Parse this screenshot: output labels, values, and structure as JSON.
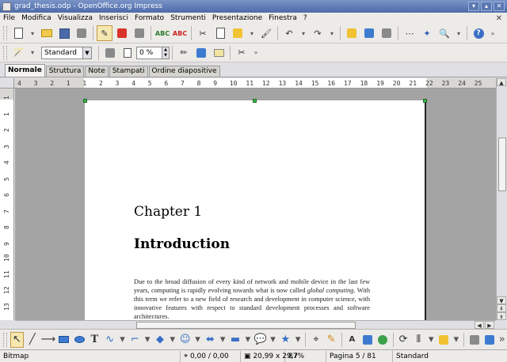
{
  "window": {
    "title": "grad_thesis.odp - OpenOffice.org Impress",
    "controls": [
      "▾",
      "▴",
      "✕"
    ]
  },
  "menu": [
    "File",
    "Modifica",
    "Visualizza",
    "Inserisci",
    "Formato",
    "Strumenti",
    "Presentazione",
    "Finestra",
    "?"
  ],
  "toolbar2": {
    "style_value": "Standard",
    "transparency_value": "0 %"
  },
  "tabs": [
    "Normale",
    "Struttura",
    "Note",
    "Stampati",
    "Ordine diapositive"
  ],
  "ruler": {
    "h_ticks": [
      "4",
      "3",
      "2",
      "1",
      "1",
      "2",
      "3",
      "4",
      "5",
      "6",
      "7",
      "8",
      "9",
      "10",
      "11",
      "12",
      "13",
      "14",
      "15",
      "16",
      "17",
      "18",
      "19",
      "20",
      "21",
      "22",
      "23",
      "24",
      "25"
    ],
    "v_ticks": [
      "1",
      "1",
      "2",
      "3",
      "4",
      "5",
      "6",
      "7",
      "8",
      "9",
      "10",
      "11",
      "12",
      "13"
    ]
  },
  "slide": {
    "chapter": "Chapter 1",
    "heading": "Introduction",
    "paragraph_start": "Due to the broad diffusion of every kind of network and mobile device in the last few years, computing is rapidly evolving towards what is now called ",
    "paragraph_em": "global computing.",
    "paragraph_end": " With this term we refer to a new field of research and development in computer science, with innovative features with respect to standard development processes and software architectures."
  },
  "status": {
    "object": "Bitmap",
    "position": "0,00 / 0,00",
    "size": "20,99 x 29,7",
    "zoom": "87%",
    "page": "Pagina 5 / 81",
    "layout": "Standard"
  }
}
